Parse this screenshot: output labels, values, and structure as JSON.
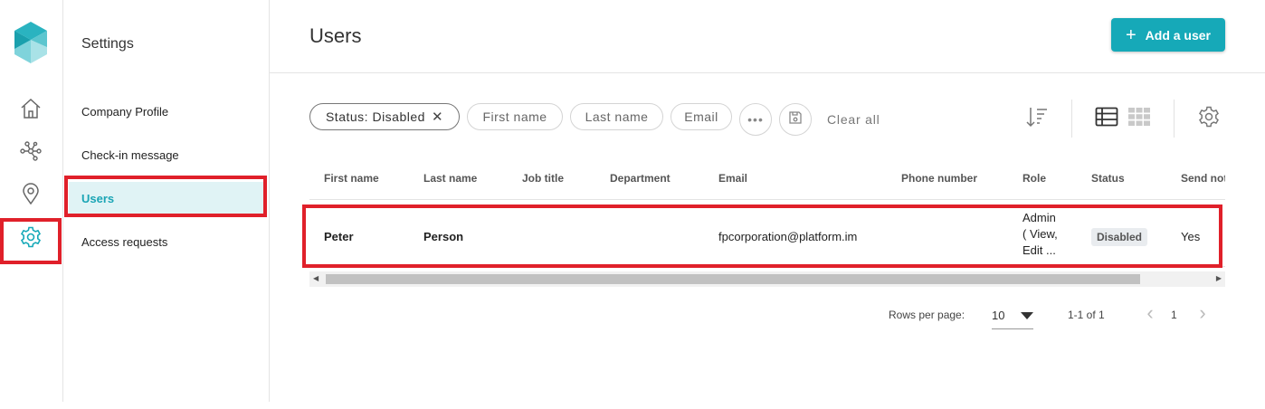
{
  "colors": {
    "accent": "#16a9b8",
    "highlight": "#e0202a",
    "active_nav_bg": "#e0f3f5"
  },
  "rail": {
    "items": [
      {
        "name": "home",
        "icon": "home-icon"
      },
      {
        "name": "network",
        "icon": "network-icon"
      },
      {
        "name": "location",
        "icon": "location-pin-icon"
      },
      {
        "name": "settings",
        "icon": "gear-icon",
        "active": true
      }
    ]
  },
  "settings": {
    "title": "Settings",
    "items": [
      {
        "label": "Company Profile"
      },
      {
        "label": "Check-in message"
      },
      {
        "label": "Users",
        "active": true
      },
      {
        "label": "Access requests"
      }
    ]
  },
  "header": {
    "title": "Users",
    "add_button": "Add a user"
  },
  "filters": {
    "status_key": "Status:",
    "status_value": "Disabled",
    "chips": [
      "First name",
      "Last name",
      "Email"
    ],
    "clear_all": "Clear all"
  },
  "table": {
    "columns": [
      "First name",
      "Last name",
      "Job title",
      "Department",
      "Email",
      "Phone number",
      "Role",
      "Status",
      "Send not"
    ],
    "rows": [
      {
        "first_name": "Peter",
        "last_name": "Person",
        "job_title": "",
        "department": "",
        "email": "fpcorporation@platform.im",
        "phone": "",
        "role_lines": [
          "Admin",
          "( View,",
          "Edit ..."
        ],
        "status": "Disabled",
        "send": "Yes"
      }
    ]
  },
  "pagination": {
    "rows_per_page_label": "Rows per page:",
    "rows_per_page": "10",
    "range": "1-1 of 1",
    "page": "1"
  }
}
